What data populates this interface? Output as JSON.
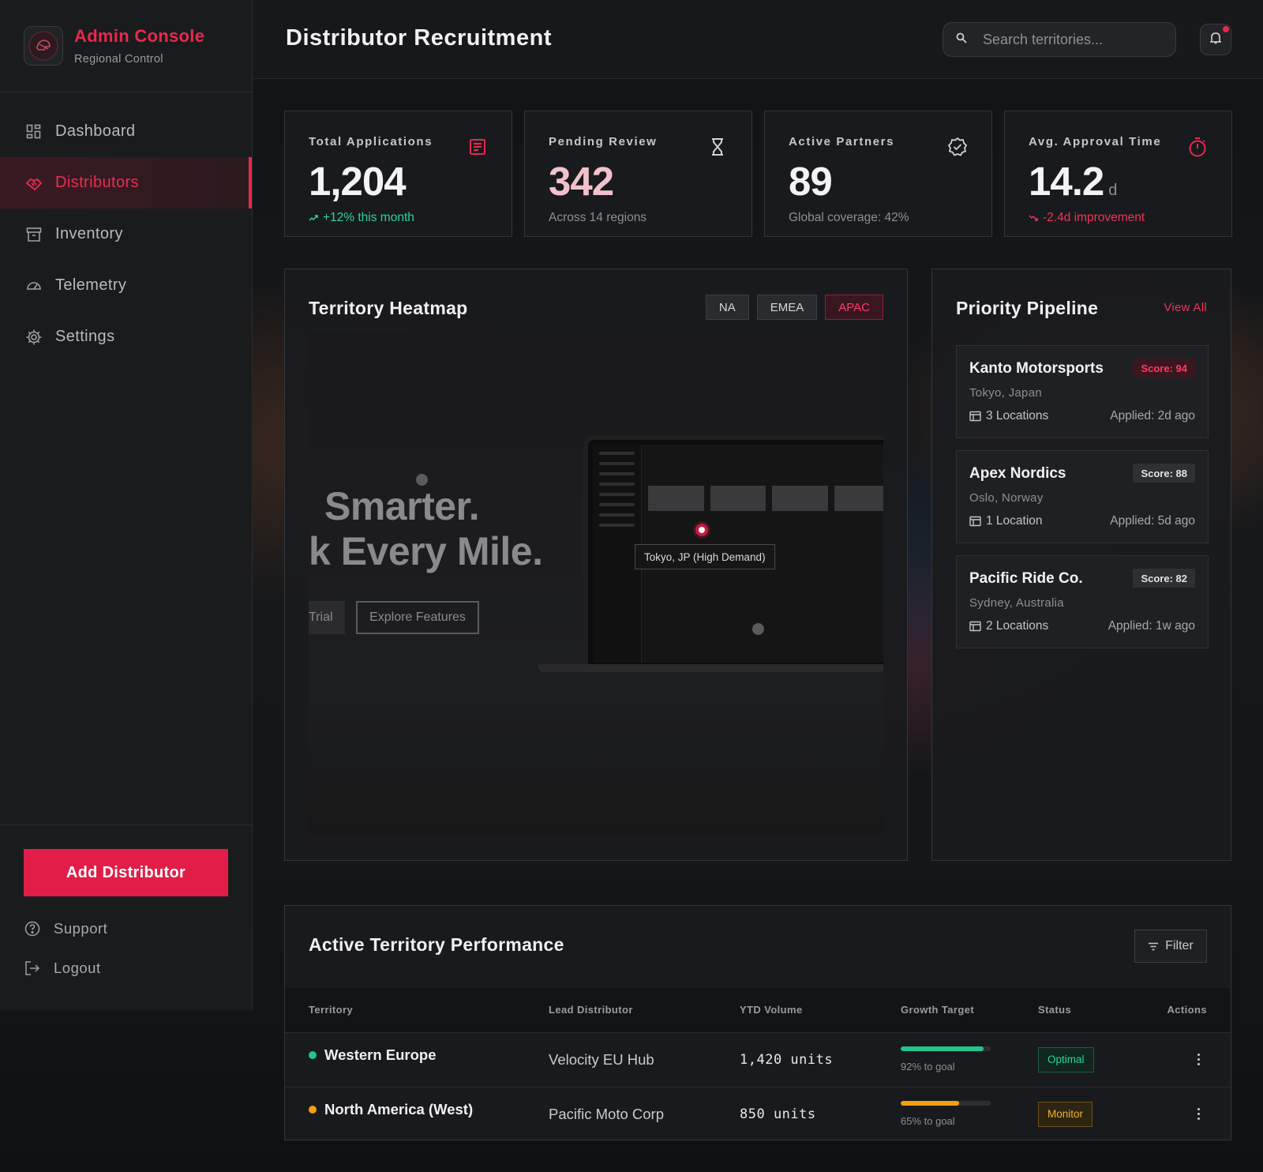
{
  "brand": {
    "title": "Admin Console",
    "subtitle": "Regional Control"
  },
  "nav": [
    {
      "label": "Dashboard",
      "icon": "grid-icon",
      "active": false
    },
    {
      "label": "Distributors",
      "icon": "handshake-icon",
      "active": true
    },
    {
      "label": "Inventory",
      "icon": "archive-box-icon",
      "active": false
    },
    {
      "label": "Telemetry",
      "icon": "gauge-icon",
      "active": false
    },
    {
      "label": "Settings",
      "icon": "gear-icon",
      "active": false
    }
  ],
  "sidebar_actions": {
    "add_label": "Add Distributor",
    "support_label": "Support",
    "logout_label": "Logout"
  },
  "header": {
    "title": "Distributor Recruitment",
    "search_placeholder": "Search territories..."
  },
  "stats": [
    {
      "label": "Total Applications",
      "value": "1,204",
      "unit": "",
      "foot": "+12% this month",
      "trend": "up",
      "icon": "document-icon"
    },
    {
      "label": "Pending Review",
      "value": "342",
      "unit": "",
      "foot": "Across 14 regions",
      "trend": "neutral",
      "icon": "hourglass-icon"
    },
    {
      "label": "Active Partners",
      "value": "89",
      "unit": "",
      "foot": "Global coverage: 42%",
      "trend": "neutral",
      "icon": "verified-badge-icon"
    },
    {
      "label": "Avg. Approval Time",
      "value": "14.2",
      "unit": "d",
      "foot": "-2.4d improvement",
      "trend": "down",
      "icon": "stopwatch-icon"
    }
  ],
  "heatmap": {
    "title": "Territory Heatmap",
    "tabs": [
      {
        "label": "NA",
        "active": false
      },
      {
        "label": "EMEA",
        "active": false
      },
      {
        "label": "APAC",
        "active": true
      }
    ],
    "hero_line1": "Smarter.",
    "hero_line2": "k Every Mile.",
    "hero_btn_trial": "Trial",
    "hero_btn_explore": "Explore Features",
    "tooltip": "Tokyo, JP (High Demand)"
  },
  "pipeline": {
    "title": "Priority Pipeline",
    "view_all": "View All",
    "items": [
      {
        "name": "Kanto Motorsports",
        "location": "Tokyo, Japan",
        "score": "Score: 94",
        "locations": "3 Locations",
        "applied": "Applied: 2d ago",
        "highlight": true
      },
      {
        "name": "Apex Nordics",
        "location": "Oslo, Norway",
        "score": "Score: 88",
        "locations": "1 Location",
        "applied": "Applied: 5d ago",
        "highlight": false
      },
      {
        "name": "Pacific Ride Co.",
        "location": "Sydney, Australia",
        "score": "Score: 82",
        "locations": "2 Locations",
        "applied": "Applied: 1w ago",
        "highlight": false
      }
    ]
  },
  "performance": {
    "title": "Active Territory Performance",
    "filter_label": "Filter",
    "columns": [
      "Territory",
      "Lead Distributor",
      "YTD Volume",
      "Growth Target",
      "Status",
      "Actions"
    ],
    "rows": [
      {
        "territory": "Western Europe",
        "dot_color": "#22c58b",
        "lead": "Velocity EU Hub",
        "volume": "1,420 units",
        "progress": 0.92,
        "progress_color": "#22c58b",
        "progress_label": "92% to goal",
        "status": "Optimal",
        "status_kind": "ok"
      },
      {
        "territory": "North America (West)",
        "dot_color": "#f59e0b",
        "lead": "Pacific Moto Corp",
        "volume": "850 units",
        "progress": 0.65,
        "progress_color": "#f59e0b",
        "progress_label": "65% to goal",
        "status": "Monitor",
        "status_kind": "warn"
      }
    ]
  },
  "colors": {
    "accent": "#e11d48",
    "success": "#2dd4a0",
    "warning": "#f5b32a",
    "danger": "#ee3457"
  }
}
